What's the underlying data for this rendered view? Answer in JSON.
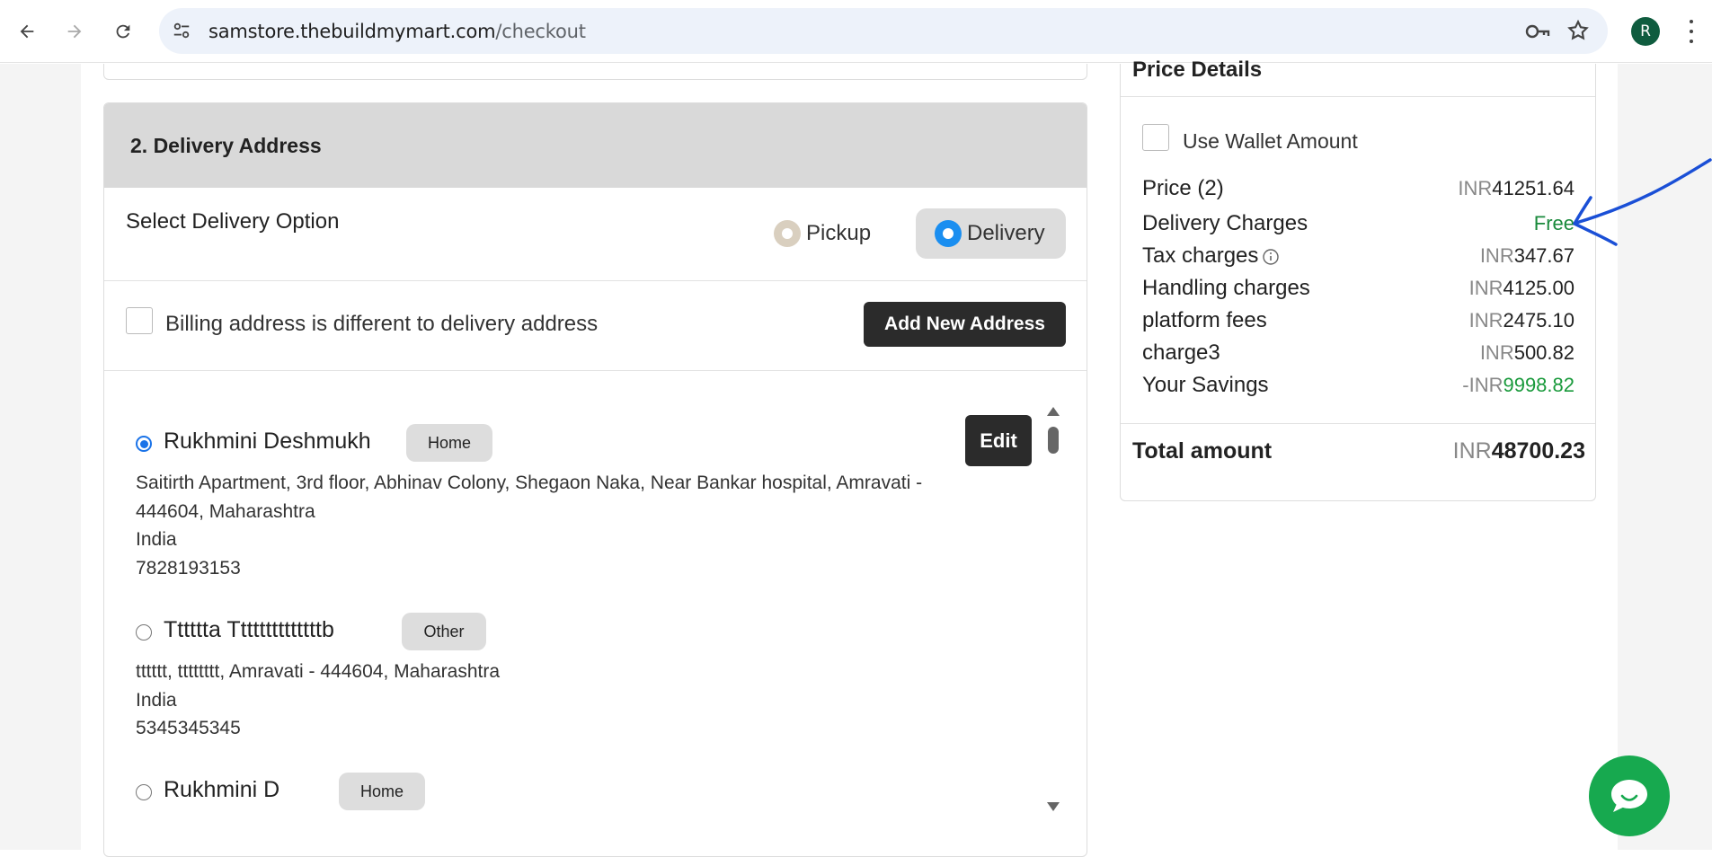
{
  "browser": {
    "url_host": "samstore.thebuildmymart.com",
    "url_path": "/checkout",
    "avatar_letter": "R"
  },
  "delivery": {
    "section_title": "2. Delivery Address",
    "option_title": "Select Delivery Option",
    "pickup_label": "Pickup",
    "delivery_label": "Delivery",
    "selected_option": "Delivery",
    "billing_label": "Billing address is different to delivery address",
    "add_new_label": "Add New Address",
    "edit_label": "Edit",
    "addresses": [
      {
        "name": "Rukhmini Deshmukh",
        "tag": "Home",
        "selected": true,
        "line1": "Saitirth Apartment, 3rd floor, Abhinav Colony, Shegaon Naka, Near Bankar hospital, Amravati -",
        "line2": "444604, Maharashtra",
        "country": "India",
        "phone": "7828193153"
      },
      {
        "name": "Tttttta Ttttttttttttttb",
        "tag": "Other",
        "selected": false,
        "line1": "tttttt, tttttttt, Amravati - 444604, Maharashtra",
        "country": "India",
        "phone": "5345345345"
      },
      {
        "name": "Rukhmini D",
        "tag": "Home",
        "selected": false
      }
    ]
  },
  "price": {
    "title": "Price Details",
    "wallet_label": "Use Wallet Amount",
    "currency": "INR",
    "rows": [
      {
        "label": "Price (2)",
        "amount": "41251.64"
      },
      {
        "label": "Delivery Charges",
        "amount": "Free"
      },
      {
        "label": "Tax charges",
        "amount": "347.67"
      },
      {
        "label": "Handling charges",
        "amount": "4125.00"
      },
      {
        "label": "platform fees",
        "amount": "2475.10"
      },
      {
        "label": "charge3",
        "amount": "500.82"
      },
      {
        "label": "Your Savings",
        "prefix": "-INR",
        "amount": "9998.82"
      }
    ],
    "total_label": "Total amount",
    "total_amount": "48700.23"
  },
  "colors": {
    "accent_blue": "#1a8ef0",
    "free_green": "#1a8a3c",
    "chat_green": "#17a94f",
    "dark_button": "#2b2b2b",
    "annotation_blue": "#1a4fd6"
  }
}
